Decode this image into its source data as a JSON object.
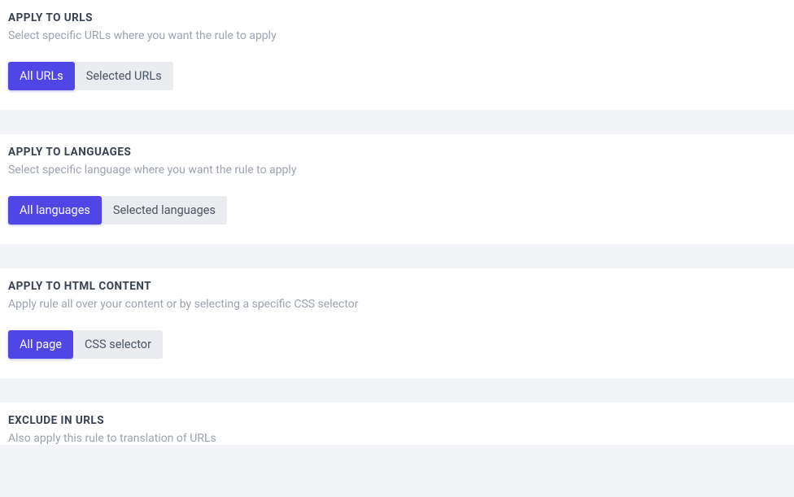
{
  "sections": {
    "applyUrls": {
      "title": "APPLY TO URLS",
      "subtitle": "Select specific URLs where you want the rule to apply",
      "options": {
        "all": "All URLs",
        "selected": "Selected URLs"
      }
    },
    "applyLanguages": {
      "title": "APPLY TO LANGUAGES",
      "subtitle": "Select specific language where you want the rule to apply",
      "options": {
        "all": "All languages",
        "selected": "Selected languages"
      }
    },
    "applyHtml": {
      "title": "APPLY TO HTML CONTENT",
      "subtitle": "Apply rule all over your content or by selecting a specific CSS selector",
      "options": {
        "all": "All page",
        "selector": "CSS selector"
      }
    },
    "excludeUrls": {
      "title": "EXCLUDE IN URLS",
      "subtitle": "Also apply this rule to translation of URLs"
    }
  }
}
